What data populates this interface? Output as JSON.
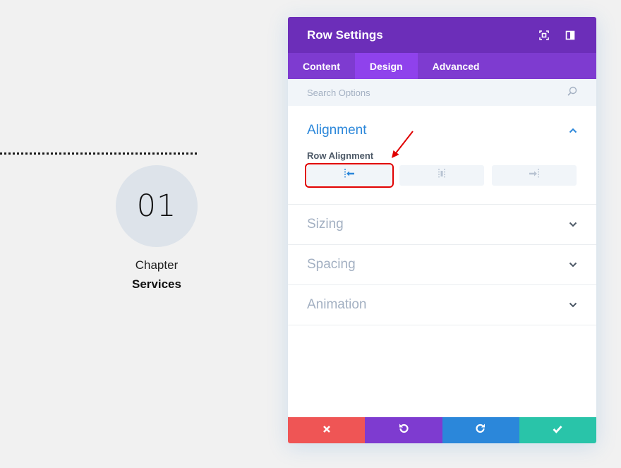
{
  "background": {
    "chapter_number": "01",
    "chapter_label": "Chapter",
    "chapter_title": "Services"
  },
  "modal": {
    "title": "Row Settings",
    "header_icons": [
      "fullscreen-icon",
      "sidebar-toggle-icon"
    ],
    "tabs": [
      {
        "label": "Content",
        "active": false
      },
      {
        "label": "Design",
        "active": true
      },
      {
        "label": "Advanced",
        "active": false
      }
    ],
    "search": {
      "placeholder": "Search Options",
      "value": ""
    },
    "alignment": {
      "title": "Alignment",
      "field_label": "Row Alignment",
      "options": [
        "align-left-icon",
        "align-center-icon",
        "align-right-icon"
      ],
      "selected": 0
    },
    "sections": [
      {
        "title": "Sizing"
      },
      {
        "title": "Spacing"
      },
      {
        "title": "Animation"
      }
    ],
    "footer": {
      "buttons": [
        {
          "icon": "close-icon",
          "color": "#ef5555"
        },
        {
          "icon": "undo-icon",
          "color": "#7e3bd0"
        },
        {
          "icon": "redo-icon",
          "color": "#2b87da"
        },
        {
          "icon": "checkmark-icon",
          "color": "#29c4a9"
        }
      ]
    }
  },
  "colors": {
    "header": "#6c2eb9",
    "tabs": "#7e3bd0",
    "active_tab": "#8f42ec",
    "accent_blue": "#2b87da",
    "annotation_red": "#e00000"
  }
}
